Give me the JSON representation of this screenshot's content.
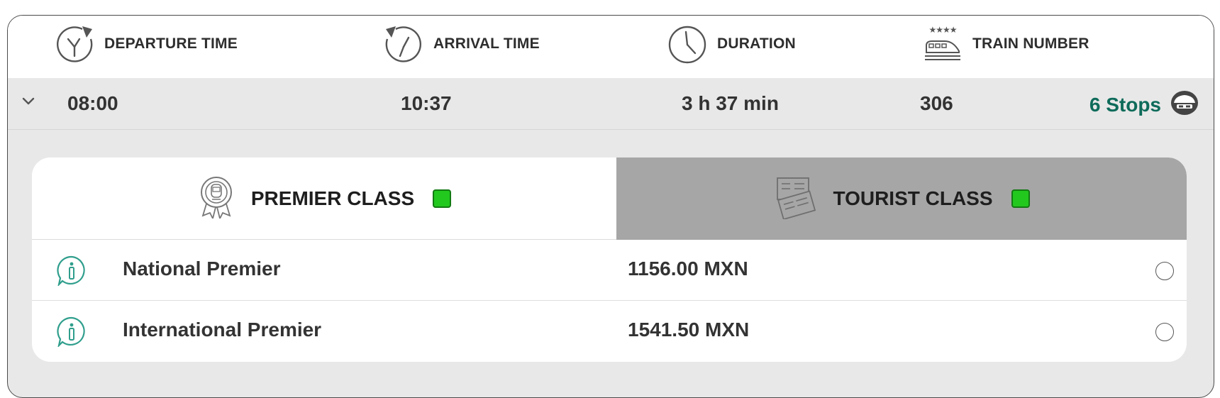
{
  "header": {
    "departure_label": "DEPARTURE TIME",
    "arrival_label": "ARRIVAL TIME",
    "duration_label": "DURATION",
    "train_number_label": "TRAIN NUMBER",
    "train_icon_stars": "★★★★",
    "icons": {
      "departure": "departure-clock-icon",
      "arrival": "arrival-clock-icon",
      "duration": "clock-icon",
      "train_number": "train-icon"
    }
  },
  "trip": {
    "departure": "08:00",
    "arrival": "10:37",
    "duration": "3 h 37 min",
    "train_number": "306",
    "stops": "6 Stops"
  },
  "tabs": [
    {
      "label": "PREMIER CLASS",
      "selected": true,
      "icon": "award-badge-icon"
    },
    {
      "label": "TOURIST CLASS",
      "selected": false,
      "icon": "tickets-icon"
    }
  ],
  "fares": [
    {
      "name": "National Premier",
      "price": "1156.00 MXN",
      "selected": false
    },
    {
      "name": "International Premier",
      "price": "1541.50 MXN",
      "selected": false
    }
  ],
  "colors": {
    "accent_green": "#0e6b5a",
    "status_square": "#22c81e",
    "tab_inactive": "#a6a6a6",
    "background_gray": "#e8e8e8"
  }
}
